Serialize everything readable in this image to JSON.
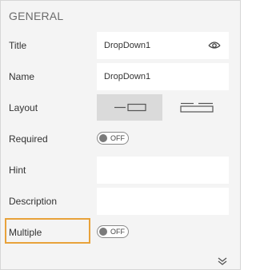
{
  "section": {
    "title": "GENERAL"
  },
  "fields": {
    "title": {
      "label": "Title",
      "value": "DropDown1"
    },
    "name": {
      "label": "Name",
      "value": "DropDown1"
    },
    "layout": {
      "label": "Layout",
      "options": [
        "stacked-inline",
        "label-above"
      ]
    },
    "required": {
      "label": "Required",
      "toggle_text": "OFF"
    },
    "hint": {
      "label": "Hint",
      "value": ""
    },
    "description": {
      "label": "Description",
      "value": ""
    },
    "multiple": {
      "label": "Multiple",
      "toggle_text": "OFF"
    }
  },
  "icons": {
    "visibility": "eye-icon",
    "expand": "double-chevron-down-icon"
  },
  "colors": {
    "highlight": "#e8a23a",
    "panel_bg": "#f4f4f4",
    "selected_bg": "#dadada"
  }
}
